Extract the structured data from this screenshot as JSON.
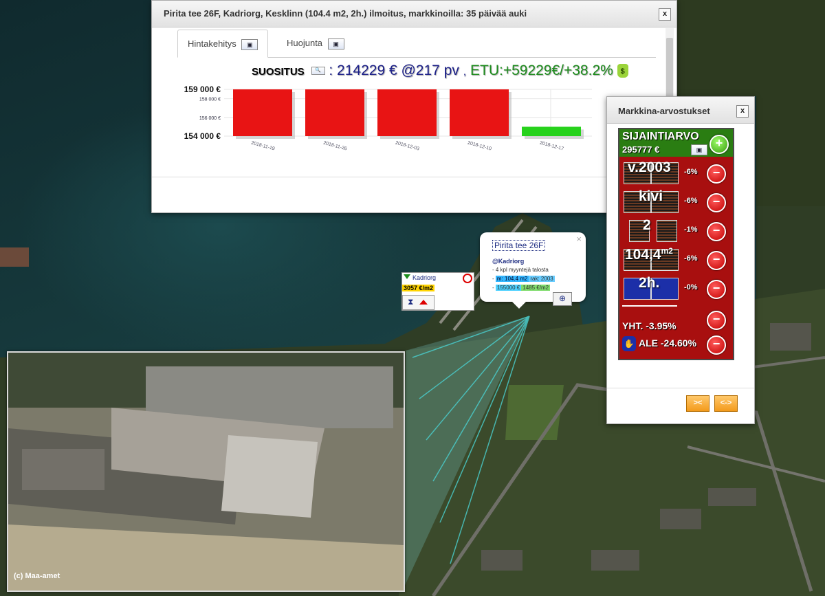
{
  "price_window": {
    "title": "Pirita tee 26F, Kadriorg, Kesklinn (104.4 m2, 2h.) ilmoitus, markkinoilla: 35 päivää auki",
    "close_label": "x",
    "tabs": [
      {
        "label": "Hintakehitys",
        "active": true
      },
      {
        "label": "Huojunta",
        "active": false
      }
    ],
    "recommendation": {
      "label": "SUOSITUS",
      "value": ": 214229 € @217 pv",
      "separator": ",",
      "etu": "ETU:+59229€/+38.2%"
    }
  },
  "chart_data": {
    "type": "bar",
    "categories": [
      "2018-11-19",
      "2018-11-26",
      "2018-12-03",
      "2018-12-10",
      "2018-12-17"
    ],
    "values": [
      159000,
      159000,
      159000,
      159000,
      155000
    ],
    "colors": [
      "#e81414",
      "#e81414",
      "#e81414",
      "#e81414",
      "#27d21c"
    ],
    "ylim": [
      154000,
      159000
    ],
    "major_ticks": [
      "159 000 €",
      "154 000 €"
    ],
    "minor_ticks": [
      "158 000 €",
      "156 000 €"
    ],
    "xlabel": "",
    "ylabel": "",
    "title": ""
  },
  "market_panel": {
    "title": "Markkina-arvostukset",
    "close_label": "x",
    "location_label": "SIJAINTIARVO",
    "location_value": "295777 €",
    "rows": [
      {
        "text": "v.2003",
        "pct": "-6%"
      },
      {
        "text": "kivi",
        "pct": "-6%"
      },
      {
        "text": "2",
        "pct": "-1%"
      },
      {
        "text": "104,4",
        "sup": "m2",
        "pct": "-6%"
      },
      {
        "text": "2h.",
        "pct": "-0%"
      }
    ],
    "total": "YHT. -3.95%",
    "discount": "ALE -24.60%",
    "button_left": "><",
    "button_right": "<->"
  },
  "info_popup": {
    "title": "Pirita tee 26F",
    "area": "@Kadriorg",
    "line1": "- 4 kpl myyntejä talosta",
    "m2": "m: 104.4 m2",
    "year": "rak: 2003",
    "price": "155000 €",
    "ppm": "1485 €/m2"
  },
  "kadriorg_marker": {
    "name": "Kadriorg",
    "price": "3057 €/m2"
  },
  "aerial": {
    "credit": "(c) Maa-amet"
  }
}
